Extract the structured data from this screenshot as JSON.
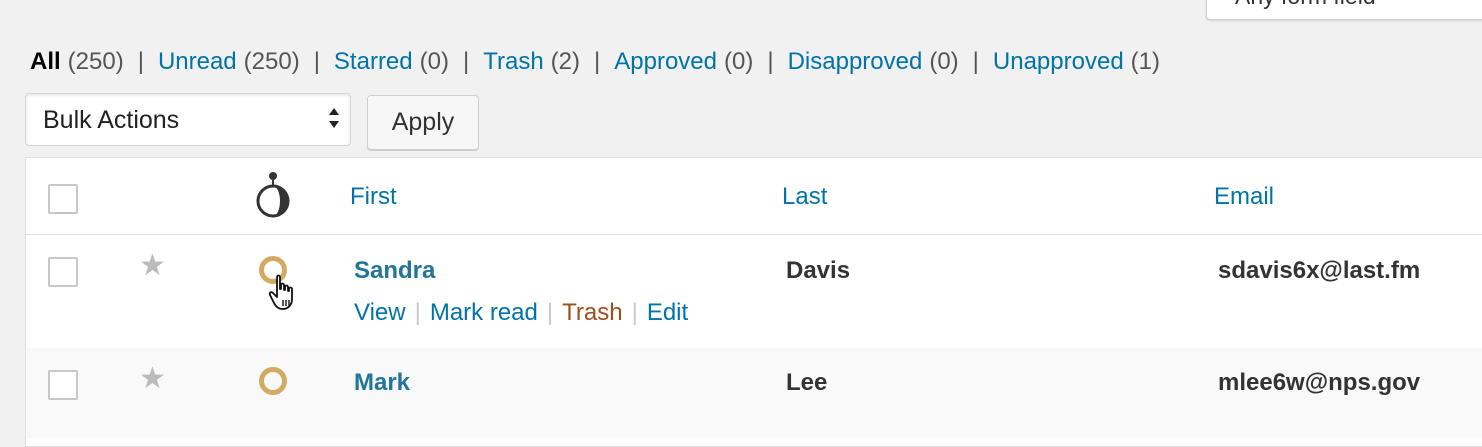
{
  "field_filter": {
    "value": "Any form field"
  },
  "filters": [
    {
      "label": "All",
      "count": "(250)"
    },
    {
      "label": "Unread",
      "count": "(250)"
    },
    {
      "label": "Starred",
      "count": "(0)"
    },
    {
      "label": "Trash",
      "count": "(2)"
    },
    {
      "label": "Approved",
      "count": "(0)"
    },
    {
      "label": "Disapproved",
      "count": "(0)"
    },
    {
      "label": "Unapproved",
      "count": "(1)"
    }
  ],
  "filter_separator": "|",
  "bulk": {
    "selected": "Bulk Actions",
    "apply_label": "Apply"
  },
  "table": {
    "columns": {
      "first": "First",
      "last": "Last",
      "email": "Email"
    },
    "header_icon": "approval-status-icon",
    "rows": [
      {
        "first": "Sandra",
        "last": "Davis",
        "email": "sdavis6x@last.fm",
        "starred": false,
        "unread": true,
        "actions": [
          "View",
          "Mark read",
          "Trash",
          "Edit"
        ]
      },
      {
        "first": "Mark",
        "last": "Lee",
        "email": "mlee6w@nps.gov",
        "starred": false,
        "unread": true
      }
    ],
    "action_separator": "|"
  },
  "colors": {
    "link": "#0073aa",
    "trash": "#a04d1b",
    "unread_ring": "#d3aa62",
    "star": "#bbbbbb"
  },
  "icons": {
    "star": "star-icon",
    "unread": "unread-circle-icon",
    "cursor": "hand-pointer-icon"
  }
}
